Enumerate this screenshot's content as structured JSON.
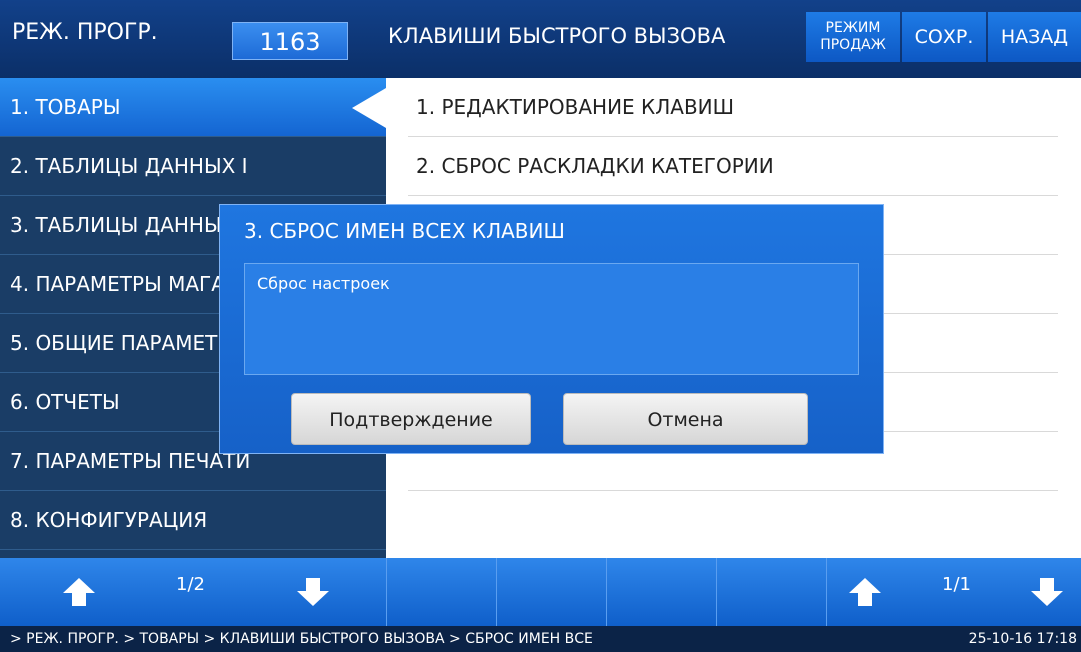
{
  "header": {
    "mode_label": "РЕЖ. ПРОГР.",
    "program_number": "1163",
    "screen_title": "КЛАВИШИ БЫСТРОГО ВЫЗОВА",
    "buttons": {
      "sales_mode_line1": "РЕЖИМ",
      "sales_mode_line2": "ПРОДАЖ",
      "save": "СОХР.",
      "back": "НАЗАД"
    }
  },
  "sidebar": {
    "items": [
      {
        "label": "1. ТОВАРЫ"
      },
      {
        "label": "2. ТАБЛИЦЫ ДАННЫХ I"
      },
      {
        "label": "3. ТАБЛИЦЫ ДАННЫХ II"
      },
      {
        "label": "4. ПАРАМЕТРЫ МАГАЗИНА"
      },
      {
        "label": "5. ОБЩИЕ ПАРАМЕТРЫ"
      },
      {
        "label": "6. ОТЧЕТЫ"
      },
      {
        "label": "7. ПАРАМЕТРЫ ПЕЧАТИ"
      },
      {
        "label": "8. КОНФИГУРАЦИЯ"
      }
    ],
    "page": "1/2"
  },
  "content": {
    "items": [
      {
        "label": "1. РЕДАКТИРОВАНИЕ КЛАВИШ"
      },
      {
        "label": "2. СБРОС РАСКЛАДКИ КАТЕГОРИИ"
      }
    ],
    "page": "1/1"
  },
  "dialog": {
    "title": "3. СБРОС ИМЕН ВСЕХ КЛАВИШ",
    "message": "Сброс настроек",
    "confirm": "Подтверждение",
    "cancel": "Отмена"
  },
  "status": {
    "breadcrumb": "> РЕЖ. ПРОГР. > ТОВАРЫ > КЛАВИШИ БЫСТРОГО ВЫЗОВА > СБРОС ИМЕН ВСЕ",
    "datetime": "25-10-16  17:18"
  },
  "colors": {
    "topbar": "#12418a",
    "sidebar": "#1a3d66",
    "accent": "#1f76e0",
    "statusbar": "#0b2347"
  },
  "icons": [
    "arrow-up-icon",
    "arrow-down-icon"
  ]
}
